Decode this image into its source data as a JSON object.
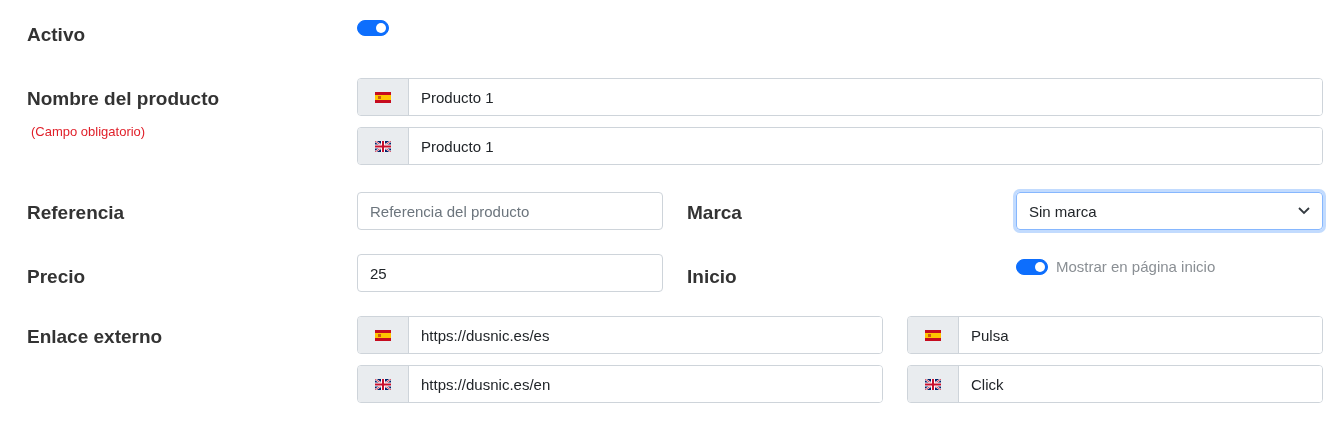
{
  "active": {
    "label": "Activo",
    "on": true
  },
  "name": {
    "label": "Nombre del producto",
    "note": "(Campo obligatorio)",
    "values": [
      {
        "kind": "es",
        "value": "Producto 1"
      },
      {
        "kind": "en",
        "value": "Producto 1"
      }
    ]
  },
  "reference": {
    "label": "Referencia",
    "placeholder": "Referencia del producto"
  },
  "brand": {
    "label": "Marca",
    "value": "Sin marca"
  },
  "price": {
    "label": "Precio",
    "value": "25"
  },
  "home": {
    "label": "Inicio",
    "on": true,
    "text": "Mostrar en página inicio"
  },
  "link": {
    "label": "Enlace externo",
    "urls": [
      {
        "kind": "es",
        "value": "https://dusnic.es/es"
      },
      {
        "kind": "en",
        "value": "https://dusnic.es/en"
      }
    ],
    "texts": [
      {
        "kind": "es",
        "value": "Pulsa"
      },
      {
        "kind": "en",
        "value": "Click"
      }
    ]
  }
}
